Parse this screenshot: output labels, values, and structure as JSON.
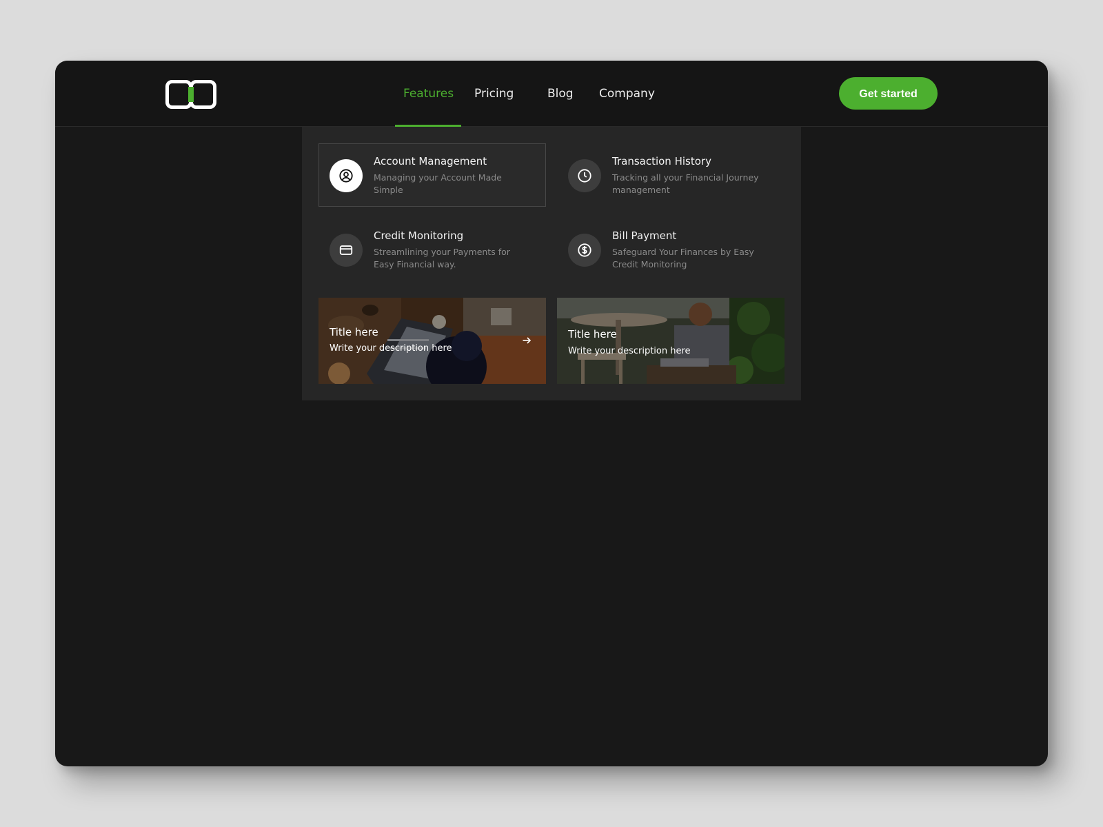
{
  "brand": {
    "accent_color": "#4caf2f",
    "logo_icon": "brand-logo-icon"
  },
  "nav": {
    "items": [
      {
        "label": "Features",
        "active": true
      },
      {
        "label": "Pricing",
        "active": false
      },
      {
        "label": "Blog",
        "active": false
      },
      {
        "label": "Company",
        "active": false
      }
    ]
  },
  "header": {
    "cta_label": "Get started"
  },
  "dropdown": {
    "features": [
      {
        "title": "Account Management",
        "description": "Managing your Account Made Simple",
        "icon": "user-circle-icon",
        "selected": true
      },
      {
        "title": "Transaction History",
        "description": "Tracking all your Financial Journey management",
        "icon": "clock-icon",
        "selected": false
      },
      {
        "title": "Credit Monitoring",
        "description": "Streamlining your Payments for Easy Financial way.",
        "icon": "credit-card-icon",
        "selected": false
      },
      {
        "title": "Bill Payment",
        "description": "Safeguard Your Finances by Easy Credit Monitoring",
        "icon": "dollar-circle-icon",
        "selected": false
      }
    ],
    "cards": [
      {
        "title": "Title here",
        "description": "Write your description here",
        "has_arrow": true
      },
      {
        "title": "Title here",
        "description": "Write your description here",
        "has_arrow": false
      }
    ]
  }
}
